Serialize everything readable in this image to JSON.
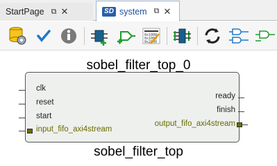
{
  "tabs": [
    {
      "label": "StartPage",
      "restore_icon": "restore-icon",
      "close_icon": "close-icon"
    },
    {
      "label": "system",
      "badge": "SD",
      "restore_icon": "restore-icon",
      "close_icon": "close-icon"
    }
  ],
  "toolbar": {
    "buttons": [
      "db-settings-icon",
      "check-icon",
      "info-icon",
      "add-component-icon",
      "add-port-icon",
      "address-editor-icon",
      "arrange-icon",
      "refresh-icon",
      "connect-ports-icon",
      "disconnect-icon"
    ]
  },
  "diagram": {
    "instance_name": "sobel_filter_top_0",
    "module_name": "sobel_filter_top",
    "inputs": [
      "clk",
      "reset",
      "start"
    ],
    "input_interface": "input_fifo_axi4stream",
    "outputs": [
      "ready",
      "finish"
    ],
    "output_interface": "output_fifo_axi4stream",
    "colors": {
      "block_fill": "#eef0ee",
      "interface": "#6b6b00"
    }
  }
}
